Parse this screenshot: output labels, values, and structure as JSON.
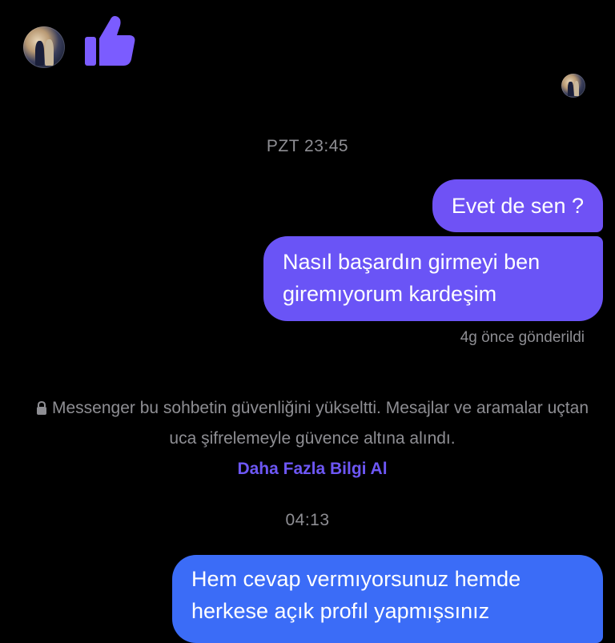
{
  "header": {
    "avatar_icon": "profile-photo",
    "reaction_icon": "thumbs-up-icon",
    "reaction_color": "#7b5cff"
  },
  "conversation": {
    "timestamp_1": "PZT 23:45",
    "messages_sent_1": [
      "Evet de sen ?",
      "Nasıl başardın girmeyi ben giremıyorum kardeşim"
    ],
    "sent_status": "4g önce gönderildi",
    "security_notice": {
      "text": "Messenger bu sohbetin güvenliğini yükseltti. Mesajlar ve aramalar uçtan uca şifrelemeyle güvence altına alındı.",
      "link": "Daha Fazla Bilgi Al",
      "icon": "lock-icon"
    },
    "timestamp_2": "04:13",
    "message_sent_2": "Hem cevap vermıyorsunuz hemde herkese açık profıl yapmışsınız"
  },
  "colors": {
    "background": "#000000",
    "bubble_purple": "#6a54f6",
    "bubble_blue": "#3b6cf7",
    "link": "#6d57f5",
    "muted_text": "#8e8e93"
  }
}
